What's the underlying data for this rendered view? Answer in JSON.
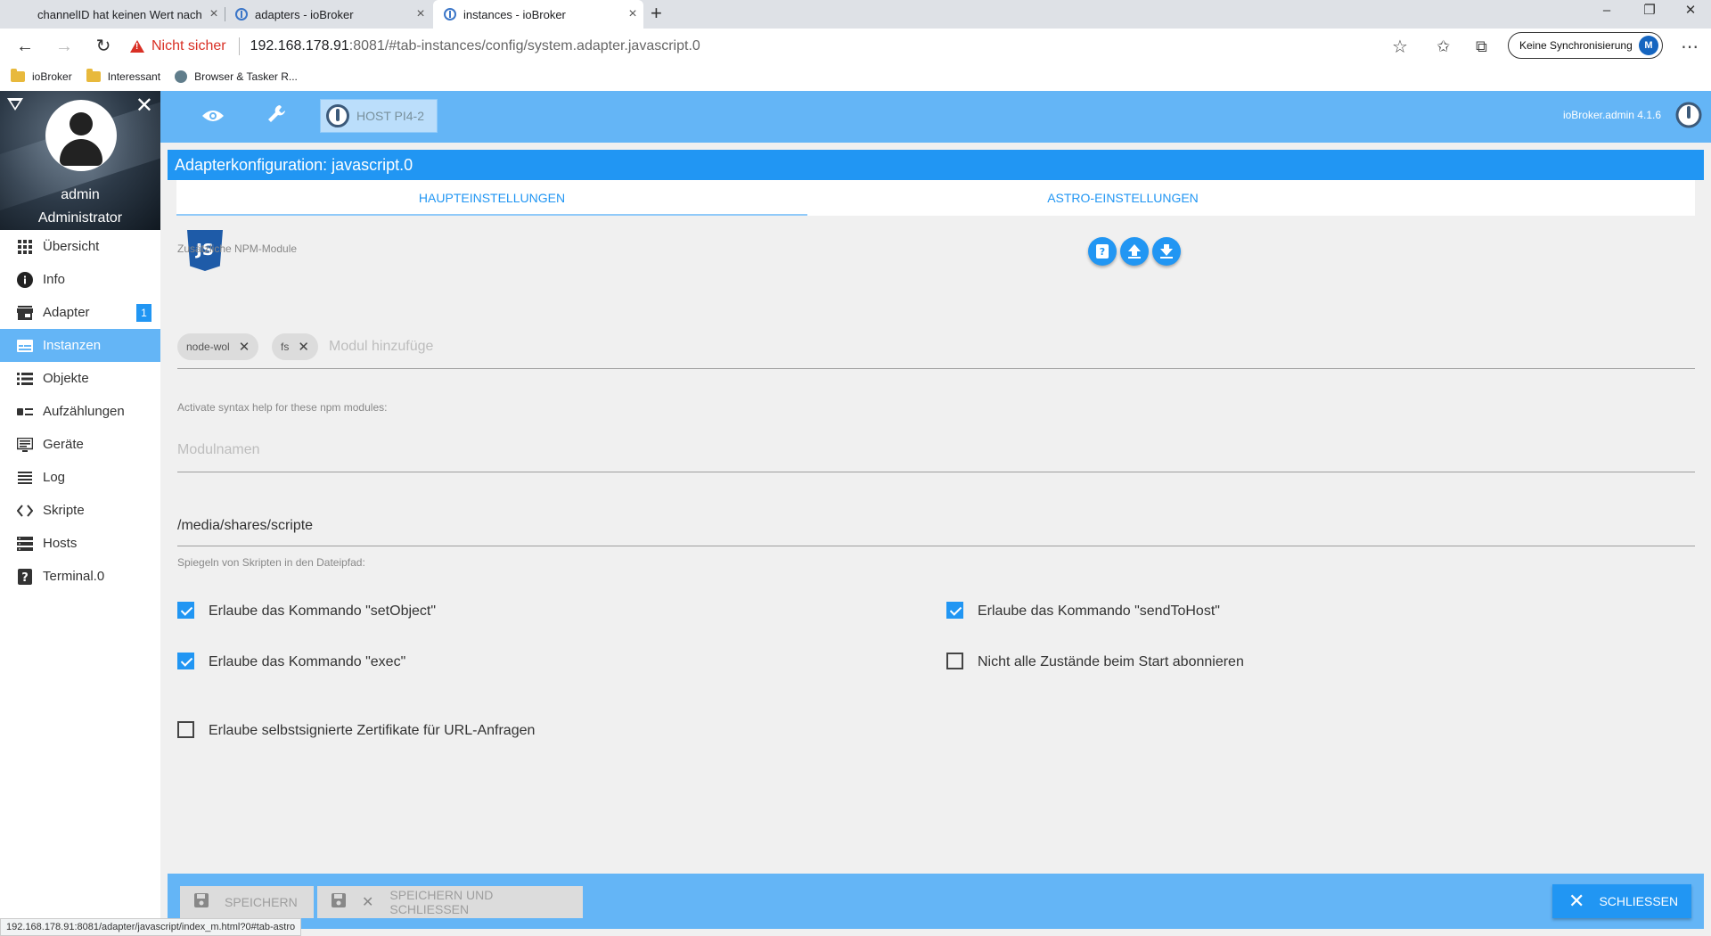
{
  "browser": {
    "tabs": [
      {
        "title": "channelID hat keinen Wert nach"
      },
      {
        "title": "adapters - ioBroker"
      },
      {
        "title": "instances - ioBroker"
      }
    ],
    "security_label": "Nicht sicher",
    "url_host": "192.168.178.91",
    "url_rest": ":8081/#tab-instances/config/system.adapter.javascript.0",
    "sync_label": "Keine Synchronisierung",
    "bookmarks": [
      "ioBroker",
      "Interessant",
      "Browser & Tasker R..."
    ],
    "status_url": "192.168.178.91:8081/adapter/javascript/index_m.html?0#tab-astro"
  },
  "app": {
    "host_button": "HOST PI4-2",
    "version": "ioBroker.admin 4.1.6",
    "profile": {
      "name": "admin",
      "role": "Administrator"
    },
    "nav": [
      {
        "label": "Übersicht",
        "icon": "grid-icon"
      },
      {
        "label": "Info",
        "icon": "info-icon"
      },
      {
        "label": "Adapter",
        "icon": "store-icon",
        "badge": "1"
      },
      {
        "label": "Instanzen",
        "icon": "instances-icon",
        "active": true
      },
      {
        "label": "Objekte",
        "icon": "list-icon"
      },
      {
        "label": "Aufzählungen",
        "icon": "enum-icon"
      },
      {
        "label": "Geräte",
        "icon": "devices-icon"
      },
      {
        "label": "Log",
        "icon": "log-icon"
      },
      {
        "label": "Skripte",
        "icon": "code-icon"
      },
      {
        "label": "Hosts",
        "icon": "hosts-icon"
      },
      {
        "label": "Terminal.0",
        "icon": "help-icon"
      }
    ]
  },
  "config": {
    "title": "Adapterkonfiguration: javascript.0",
    "tabs": [
      "HAUPTEINSTELLUNGEN",
      "ASTRO-EINSTELLUNGEN"
    ],
    "npm_label": "Zusätzliche NPM-Module",
    "npm_chips": [
      "node-wol",
      "fs"
    ],
    "npm_placeholder": "Modul hinzufüge",
    "syntax_label": "Activate syntax help for these npm modules:",
    "syntax_placeholder": "Modulnamen",
    "mirror_path": "/media/shares/scripte",
    "mirror_label": "Spiegeln von Skripten in den Dateipfad:",
    "checkboxes": {
      "set_object": {
        "label": "Erlaube das Kommando \"setObject\"",
        "checked": true
      },
      "send_to_host": {
        "label": "Erlaube das Kommando \"sendToHost\"",
        "checked": true
      },
      "exec": {
        "label": "Erlaube das Kommando \"exec\"",
        "checked": true
      },
      "subscribe": {
        "label": "Nicht alle Zustände beim Start abonnieren",
        "checked": false
      },
      "self_signed": {
        "label": "Erlaube selbstsignierte Zertifikate für URL-Anfragen",
        "checked": false
      }
    },
    "footer": {
      "save": "SPEICHERN",
      "save_close": "SPEICHERN UND SCHLIESSEN",
      "close": "SCHLIESSEN"
    },
    "js_logo_text": "JS"
  },
  "colors": {
    "primary": "#2196f3",
    "header": "#64b5f6",
    "warning": "#d93025"
  }
}
